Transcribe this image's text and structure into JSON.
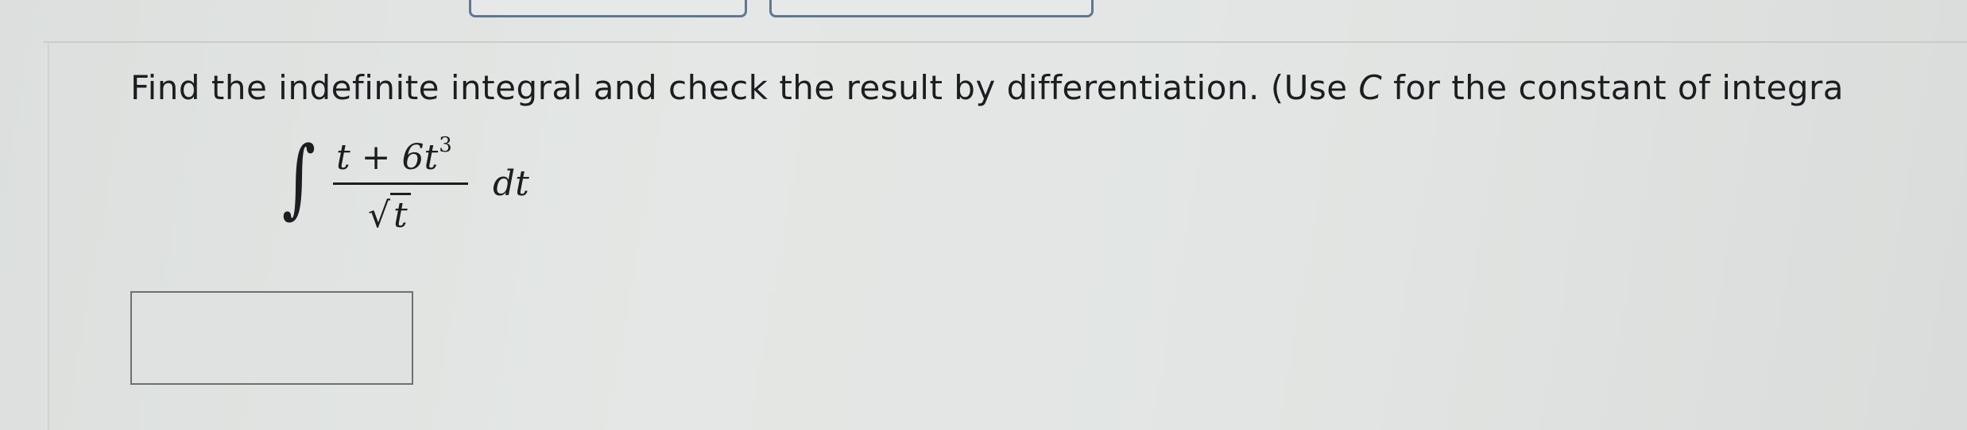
{
  "question": {
    "prefix": "Find the indefinite integral and check the result by differentiation. (Use ",
    "variable": "C",
    "suffix": " for the constant of integra"
  },
  "integral": {
    "symbol": "∫",
    "numerator_base": "t + 6t",
    "numerator_exponent": "3",
    "denominator_radical": "√",
    "denominator_radicand": "t",
    "differential": "dt"
  },
  "answer": {
    "value": ""
  }
}
